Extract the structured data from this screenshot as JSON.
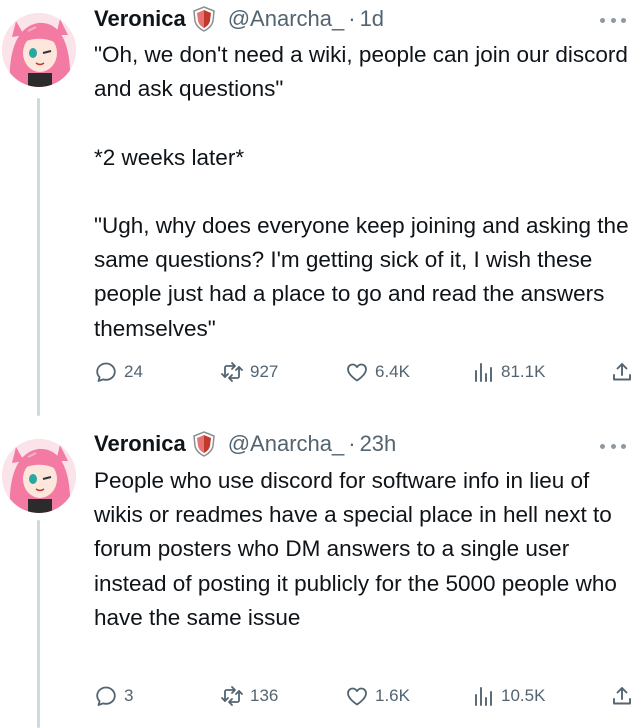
{
  "tweets": [
    {
      "display_name": "Veronica",
      "handle": "@Anarcha_",
      "separator": "·",
      "time": "1d",
      "text": "\"Oh, we don't need a wiki, people can join our discord and ask questions\"\n\n*2 weeks later*\n\n\"Ugh, why does everyone keep joining and asking the same questions? I'm getting sick of it, I wish these people just had a place to go and read the answers themselves\"",
      "replies": "24",
      "retweets": "927",
      "likes": "6.4K",
      "views": "81.1K"
    },
    {
      "display_name": "Veronica",
      "handle": "@Anarcha_",
      "separator": "·",
      "time": "23h",
      "text": "People who use discord for software info in lieu of wikis or readmes have a special place in hell next to forum posters who DM answers to a single user instead of posting it publicly for the 5000 people who have the same issue",
      "replies": "3",
      "retweets": "136",
      "likes": "1.6K",
      "views": "10.5K"
    }
  ],
  "icons": {
    "badge": "shield-badge-icon",
    "more": "more-options-icon",
    "reply": "reply-icon",
    "retweet": "retweet-icon",
    "like": "heart-icon",
    "views": "views-bar-chart-icon",
    "share": "share-upload-icon"
  },
  "colors": {
    "text": "#0f1419",
    "muted": "#536471",
    "thread_line": "#cfd9de",
    "badge_red": "#c0392b"
  }
}
